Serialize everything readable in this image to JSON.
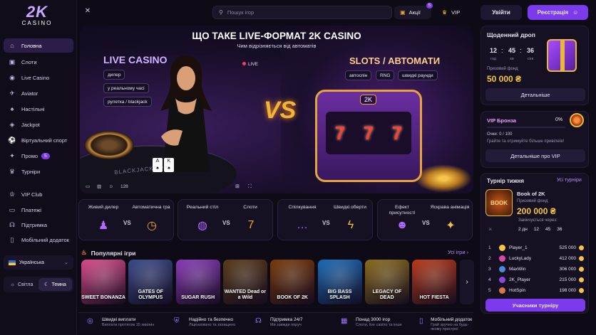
{
  "logo": {
    "big": "2K",
    "small": "CASINO"
  },
  "sidebar": {
    "items": [
      {
        "label": "Головна",
        "icon": "home-icon",
        "glyph": "⌂",
        "active": true
      },
      {
        "label": "Слоти",
        "icon": "slot-icon",
        "glyph": "▣"
      },
      {
        "label": "Live Casino",
        "icon": "live-icon",
        "glyph": "◉"
      },
      {
        "label": "Aviator",
        "icon": "plane-icon",
        "glyph": "✈"
      },
      {
        "label": "Настільні",
        "icon": "table-icon",
        "glyph": "♠"
      },
      {
        "label": "Jackpot",
        "icon": "jackpot-icon",
        "glyph": "◈"
      },
      {
        "label": "Віртуальний спорт",
        "icon": "sport-icon",
        "glyph": "⚽"
      },
      {
        "label": "Промо",
        "icon": "promo-icon",
        "glyph": "✦",
        "badge": "5"
      },
      {
        "label": "Турніри",
        "icon": "trophy-icon",
        "glyph": "♛"
      },
      {
        "label": "VIP Club",
        "icon": "crown-icon",
        "glyph": "♔"
      },
      {
        "label": "Платежі",
        "icon": "wallet-icon",
        "glyph": "▭"
      },
      {
        "label": "Підтримка",
        "icon": "headset-icon",
        "glyph": "☊"
      },
      {
        "label": "Мобільний додаток",
        "icon": "phone-icon",
        "glyph": "▯"
      }
    ],
    "language": "Українська",
    "theme_light": "Світла",
    "theme_dark": "Темна"
  },
  "topbar": {
    "search_placeholder": "Пошук ігор",
    "promo_label": "Акції",
    "promo_count": "5",
    "vip_label": "VIP",
    "login": "Увійти",
    "register": "Реєстрація"
  },
  "hero": {
    "title": "ЩО ТАКЕ LIVE-ФОРМАТ 2K CASINO",
    "subtitle": "Чим відрізняється від автоматів",
    "live_title": "LIVE CASINO",
    "live_chips": [
      "дилер",
      "у реальному часі",
      "рулетка / blackjack"
    ],
    "live_tag": "LIVE",
    "vs": "VS",
    "slots_title": "SLOTS / АВТОМАТИ",
    "slots_chips": [
      "автоспін",
      "RNG",
      "швидкі раунди"
    ],
    "felt_text": "BLACKJACK PAYS 3 TO 2",
    "viewers": "128",
    "slot_logo": "2K"
  },
  "features": [
    {
      "left": "Живий дилер",
      "right": "Автоматична гра"
    },
    {
      "left": "Реальний стіл",
      "right": "Слоти"
    },
    {
      "left": "Спілкування",
      "right": "Швидкі оберти"
    },
    {
      "left": "Ефект присутності",
      "right": "Яскрава анімація"
    }
  ],
  "feature_vs": "VS",
  "popular": {
    "title": "Популярні ігри",
    "all": "Усі ігри",
    "games": [
      {
        "name": "SWEET BONANZA",
        "bg": "#d94a8a"
      },
      {
        "name": "GATES OF OLYMPUS",
        "bg": "#3a4a8a"
      },
      {
        "name": "SUGAR RUSH",
        "bg": "#8a3ab8"
      },
      {
        "name": "WANTED Dead or a Wild",
        "bg": "#5a3a1a"
      },
      {
        "name": "BOOK OF 2K",
        "bg": "#7a3a0a"
      },
      {
        "name": "BIG BASS SPLASH",
        "bg": "#1a6ab8"
      },
      {
        "name": "LEGACY OF DEAD",
        "bg": "#8a6a1a"
      },
      {
        "name": "HOT FIESTA",
        "bg": "#b83a1a"
      }
    ]
  },
  "bottom": [
    {
      "t1": "Швидкі виплати",
      "t2": "Виплати протягом 15 хвилин",
      "icon": "payout-icon",
      "glyph": "◎"
    },
    {
      "t1": "Надійно та безпечно",
      "t2": "Ліцензовано та захищено",
      "icon": "shield-icon",
      "glyph": "⛨"
    },
    {
      "t1": "Підтримка 24/7",
      "t2": "Ми завжди поруч",
      "icon": "headset-icon",
      "glyph": "☊"
    },
    {
      "t1": "Понад 3000 ігор",
      "t2": "Слоти, live casino та інше",
      "icon": "games-icon",
      "glyph": "▦"
    },
    {
      "t1": "Мобільний додаток",
      "t2": "Грай зручно на будь-якому пристрої",
      "icon": "phone-icon",
      "glyph": "▯"
    }
  ],
  "drop": {
    "title": "Щоденний дроп",
    "hours": "12",
    "minutes": "45",
    "seconds": "36",
    "h_label": "год",
    "m_label": "хв",
    "s_label": "сек",
    "fund_label": "Призовий фонд",
    "fund": "50 000 ₴",
    "button": "Детальніше"
  },
  "vip": {
    "title": "VIP Бронза",
    "percent": "0%",
    "percent_value": 0,
    "points": "Очки: 0 / 100",
    "hint": "Грайте та отримуйте більше привілеїв!",
    "button": "Детальніше про VIP"
  },
  "tournament": {
    "title": "Турнір тижня",
    "all": "Усі турніри",
    "game": "Book of 2K",
    "game_img": "BOOK",
    "fund_label": "Призовий фонд",
    "fund": "200 000 ₴",
    "ends_label": "Закінчується через:",
    "d": "2 дн",
    "h": "12",
    "m": "45",
    "s": "36",
    "ranks": [
      {
        "n": "1",
        "name": "Player_1",
        "pts": "525 000",
        "color": "#f5c542"
      },
      {
        "n": "2",
        "name": "LuckyLady",
        "pts": "412 000",
        "color": "#d64aa8"
      },
      {
        "n": "3",
        "name": "MaxWin",
        "pts": "306 000",
        "color": "#4a8ad6"
      },
      {
        "n": "4",
        "name": "2K_Player",
        "pts": "215 000",
        "color": "#8a4ad6"
      },
      {
        "n": "5",
        "name": "HotSpin",
        "pts": "198 000",
        "color": "#d6784a"
      }
    ],
    "button": "Учасники турніру"
  }
}
